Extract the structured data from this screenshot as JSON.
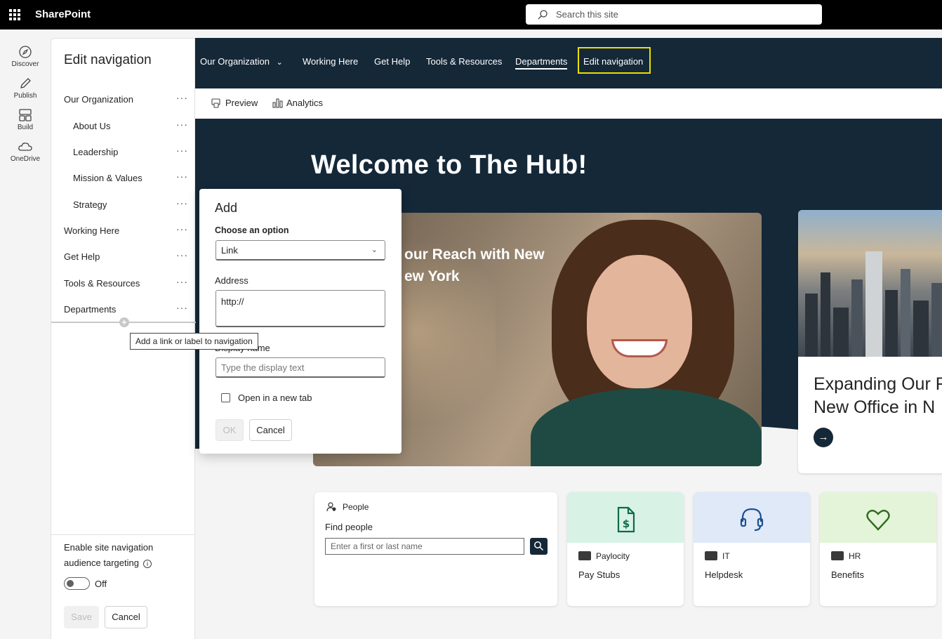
{
  "suitebar": {
    "brand": "SharePoint",
    "search_placeholder": "Search this site"
  },
  "appbar": {
    "items": [
      {
        "label": "Discover",
        "icon": "compass-icon"
      },
      {
        "label": "Publish",
        "icon": "pen-icon"
      },
      {
        "label": "Build",
        "icon": "layout-icon"
      },
      {
        "label": "OneDrive",
        "icon": "cloud-icon"
      }
    ]
  },
  "editnav": {
    "title": "Edit navigation",
    "items": [
      {
        "label": "Our Organization",
        "level": 1
      },
      {
        "label": "About Us",
        "level": 2
      },
      {
        "label": "Leadership",
        "level": 2
      },
      {
        "label": "Mission & Values",
        "level": 2
      },
      {
        "label": "Strategy",
        "level": 2
      },
      {
        "label": "Working Here",
        "level": 1
      },
      {
        "label": "Get Help",
        "level": 1
      },
      {
        "label": "Tools & Resources",
        "level": 1
      },
      {
        "label": "Departments",
        "level": 1
      }
    ],
    "more": "···",
    "insert_tooltip": "Add a link or label to navigation",
    "audience_label_line1": "Enable site navigation",
    "audience_label_line2": "audience targeting",
    "toggle_state": "Off",
    "save_label": "Save",
    "cancel_label": "Cancel"
  },
  "topnav": {
    "items": [
      "Our Organization",
      "Working Here",
      "Get Help",
      "Tools & Resources",
      "Departments",
      "Edit navigation"
    ],
    "active": "Departments",
    "highlighted": "Edit navigation",
    "highlight_color": "#e8e000"
  },
  "cmdbar": {
    "preview": "Preview",
    "analytics": "Analytics"
  },
  "hero": {
    "welcome": "Welcome to The Hub!",
    "photo_caption_line1": "our Reach with New",
    "photo_caption_line2": "ew York",
    "card_title_line1": "Expanding Our R",
    "card_title_line2": "New Office in N",
    "arrow": "→"
  },
  "tiles": {
    "people": {
      "title": "People",
      "label": "Find people",
      "placeholder": "Enter a first or last name"
    },
    "quicklinks": [
      {
        "source": "Paylocity",
        "title": "Pay Stubs",
        "icon": "dollar-document-icon",
        "bg": "#d9f2e6",
        "color": "#0e6b4a"
      },
      {
        "source": "IT",
        "title": "Helpdesk",
        "icon": "headset-icon",
        "bg": "#dfe9f7",
        "color": "#1d4f91"
      },
      {
        "source": "HR",
        "title": "Benefits",
        "icon": "heart-icon",
        "bg": "#e3f4d9",
        "color": "#2f6b1a"
      }
    ]
  },
  "dialog": {
    "title": "Add",
    "option_label": "Choose an option",
    "option_value": "Link",
    "address_label": "Address",
    "address_value": "http://",
    "display_label": "Display name",
    "display_placeholder": "Type the display text",
    "newtab_label": "Open in a new tab",
    "ok_label": "OK",
    "cancel_label": "Cancel"
  },
  "colors": {
    "navy": "#142838",
    "suitebar": "#000000"
  }
}
